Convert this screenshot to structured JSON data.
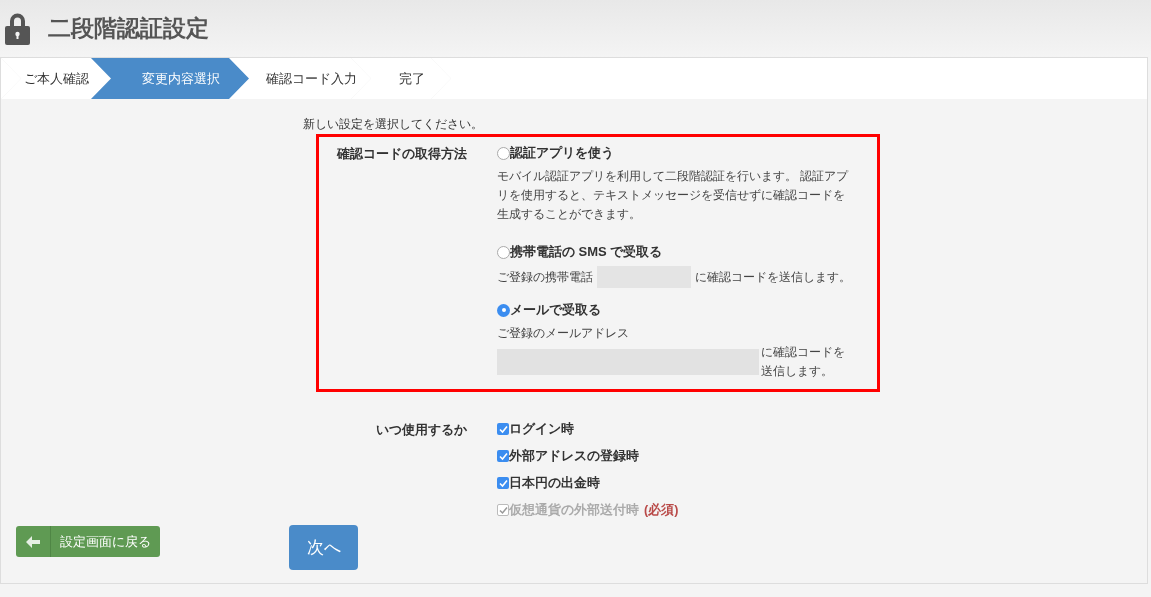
{
  "title": "二段階認証設定",
  "steps": [
    {
      "label": "ご本人確認",
      "selected": false
    },
    {
      "label": "変更内容選択",
      "selected": true
    },
    {
      "label": "確認コード入力",
      "selected": false
    },
    {
      "label": "完了",
      "selected": false
    }
  ],
  "instruction": "新しい設定を選択してください。",
  "code_method": {
    "label": "確認コードの取得方法",
    "highlighted": true,
    "options": [
      {
        "label": "認証アプリを使う",
        "selected": false,
        "description": [
          {
            "kind": "text",
            "text": "モバイル認証アプリを利用して二段階認証を行います。 認証アプリを使用すると、テキストメッセージを受信せずに確認コードを生成することができます。"
          }
        ]
      },
      {
        "label": "携帯電話の SMS で受取る",
        "selected": false,
        "description": [
          {
            "kind": "text",
            "text": "ご登録の携帯電話"
          },
          {
            "kind": "redacted"
          },
          {
            "kind": "text",
            "text": "に確認コードを送信します。"
          }
        ]
      },
      {
        "label": "メールで受取る",
        "selected": true,
        "description": [
          {
            "kind": "text",
            "text": "ご登録のメールアドレス"
          },
          {
            "kind": "redacted_long"
          },
          {
            "kind": "text",
            "text": "に確認コードを送信します。"
          }
        ]
      }
    ]
  },
  "usage": {
    "label": "いつ使用するか",
    "options": [
      {
        "label": "ログイン時",
        "checked": true,
        "disabled": false
      },
      {
        "label": "外部アドレスの登録時",
        "checked": true,
        "disabled": false
      },
      {
        "label": "日本円の出金時",
        "checked": true,
        "disabled": false
      },
      {
        "label": "仮想通貨の外部送付時",
        "checked": true,
        "disabled": true,
        "badge": "(必須)"
      }
    ]
  },
  "back_button": "設定画面に戻る",
  "next_button": "次へ"
}
